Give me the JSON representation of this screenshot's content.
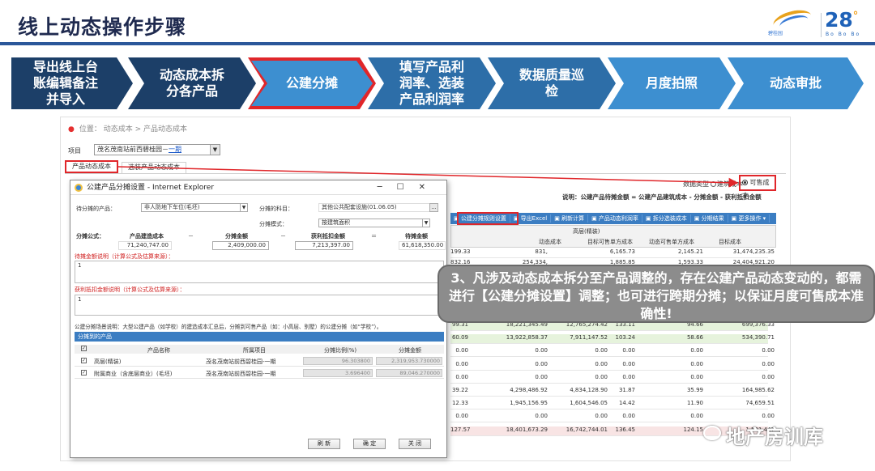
{
  "slide": {
    "title": "线上动态操作步骤",
    "logo_text": "碧桂园",
    "logo_28": "28",
    "logo_28_sub": "Bo Bo Bo"
  },
  "steps": [
    {
      "lines": [
        "导出线上台",
        "账编辑备注",
        "并导入"
      ]
    },
    {
      "lines": [
        "动态成本拆",
        "分各产品"
      ]
    },
    {
      "lines": [
        "公建分摊"
      ],
      "highlight": true
    },
    {
      "lines": [
        "填写产品利",
        "润率、选装",
        "产品利润率"
      ]
    },
    {
      "lines": [
        "数据质量巡",
        "检"
      ]
    },
    {
      "lines": [
        "月度拍照"
      ]
    },
    {
      "lines": [
        "动态审批"
      ]
    }
  ],
  "app": {
    "breadcrumb": "位置：  动态成本 > 产品动态成本",
    "project_label": "项目",
    "project_value": "茂名茂南站前西碧桂园－",
    "project_link": "一期",
    "tab_product": "产品动态成本",
    "tab_optional": "选装产品动态成本",
    "data_type_label": "数据类型",
    "radio_build": "建筑成本",
    "radio_sellable": "可售成本",
    "note": "说明：公建产品待摊金额 = 公建产品建筑成本 - 分摊金额 - 获利抵扣金额",
    "toolbar": [
      "公建分摊规则设置",
      "导出Excel",
      "刷新计算",
      "产品动态利润率",
      "拆分选装成本",
      "分期结果",
      "更多操作 ▾"
    ],
    "grid_header_group": "高层(精装)",
    "grid_cols": [
      "动态成本",
      "目标可售单方成本",
      "动态可售单方成本",
      "目标成本"
    ],
    "grid_top_rows": [
      [
        "199.33",
        "831,",
        "",
        "6,165.73",
        "2,145.21",
        "31,474,235.35"
      ],
      [
        "832.16",
        "254,334,",
        "",
        "1,885.85",
        "1,593.33",
        "24,404,921.20"
      ]
    ],
    "grid_rows": [
      [
        "99.31",
        "18,221,345.49",
        "12,765,274.42",
        "133.11",
        "94.66",
        "699,376.33",
        "green"
      ],
      [
        "60.09",
        "13,922,858.37",
        "7,911,147.52",
        "103.24",
        "58.66",
        "534,390.71",
        "green"
      ],
      [
        "0.00",
        "0.00",
        "0.00",
        "0.00",
        "0.00",
        "0.00",
        ""
      ],
      [
        "0.00",
        "0.00",
        "0.00",
        "0.00",
        "0.00",
        "0.00",
        ""
      ],
      [
        "0.00",
        "0.00",
        "0.00",
        "0.00",
        "0.00",
        "0.00",
        ""
      ],
      [
        "39.22",
        "4,298,486.92",
        "4,834,128.90",
        "31.87",
        "35.99",
        "164,985.62",
        ""
      ],
      [
        "12.33",
        "1,945,156.95",
        "1,604,546.05",
        "14.42",
        "11.90",
        "74,659.51",
        ""
      ],
      [
        "0.00",
        "0.00",
        "0.00",
        "0.00",
        "0.00",
        "0.00",
        ""
      ],
      [
        "127.57",
        "18,401,673.29",
        "16,742,744.01",
        "136.45",
        "124.15",
        "1,501,447",
        "pink"
      ]
    ]
  },
  "dialog": {
    "title": "公建产品分摊设置 - Internet Explorer",
    "pending_label": "待分摊的产品：",
    "pending_value": "非人防地下车位(毛坯)",
    "subject_label": "分摊的科目：",
    "subject_value": "其他公共配套设施(01.06.05)",
    "mode_label": "分摊模式：",
    "mode_value": "按建筑面积",
    "formula_label": "分摊公式：",
    "col_build_cost": "产品建造成本",
    "col_alloc_amount": "分摊金额",
    "col_profit_deduct": "获利抵扣金额",
    "col_pending_amount": "待摊金额",
    "val_build_cost": "71,240,747.00",
    "val_alloc_amount": "2,409,000.00",
    "val_profit_deduct": "7,213,397.00",
    "val_pending_amount": "61,618,350.00",
    "op_minus": "－",
    "op_equals": "＝",
    "pending_note_label": "待摊金额说明（计算公式及估算来源）：",
    "pending_note_value": "1",
    "profit_note_label": "获利抵扣金额说明（计算公式及估算来源）：",
    "profit_note_value": "1",
    "scene_note": "公建分摊场景说明：大型公建产品（如学校）的建造成本汇总后，分摊到可售产品（如：小高层、别墅）的公建分摊（如“学校”）。",
    "alloc_section": "分摊到的产品",
    "alloc_cols": [
      "产品名称",
      "所属项目",
      "分摊比例(%)",
      "分摊金额"
    ],
    "alloc_rows": [
      {
        "name": "高层(精装)",
        "project": "茂名茂南站前西碧桂园-一期",
        "ratio": "96.303800",
        "amount": "2,319,953.730000"
      },
      {
        "name": "附属商业（含底层商业）(毛坯)",
        "project": "茂名茂南站前西碧桂园-一期",
        "ratio": "3.696400",
        "amount": "89,046.270000"
      }
    ],
    "btn_refresh": "刷 新",
    "btn_confirm": "确 定",
    "btn_close": "关 闭"
  },
  "callout": {
    "text": "3、凡涉及动态成本拆分至产品调整的，存在公建产品动态变动的，都需进行【公建分摊设置】调整；也可进行跨期分摊；以保证月度可售成本准确性!"
  },
  "watermark": "地产房训库",
  "colors": {
    "dark_blue": "#1c3f68",
    "mid_blue": "#2d6ea8",
    "light_blue": "#3d8fd0",
    "red": "#e0262a",
    "callout_gray": "#8c8c8c"
  }
}
